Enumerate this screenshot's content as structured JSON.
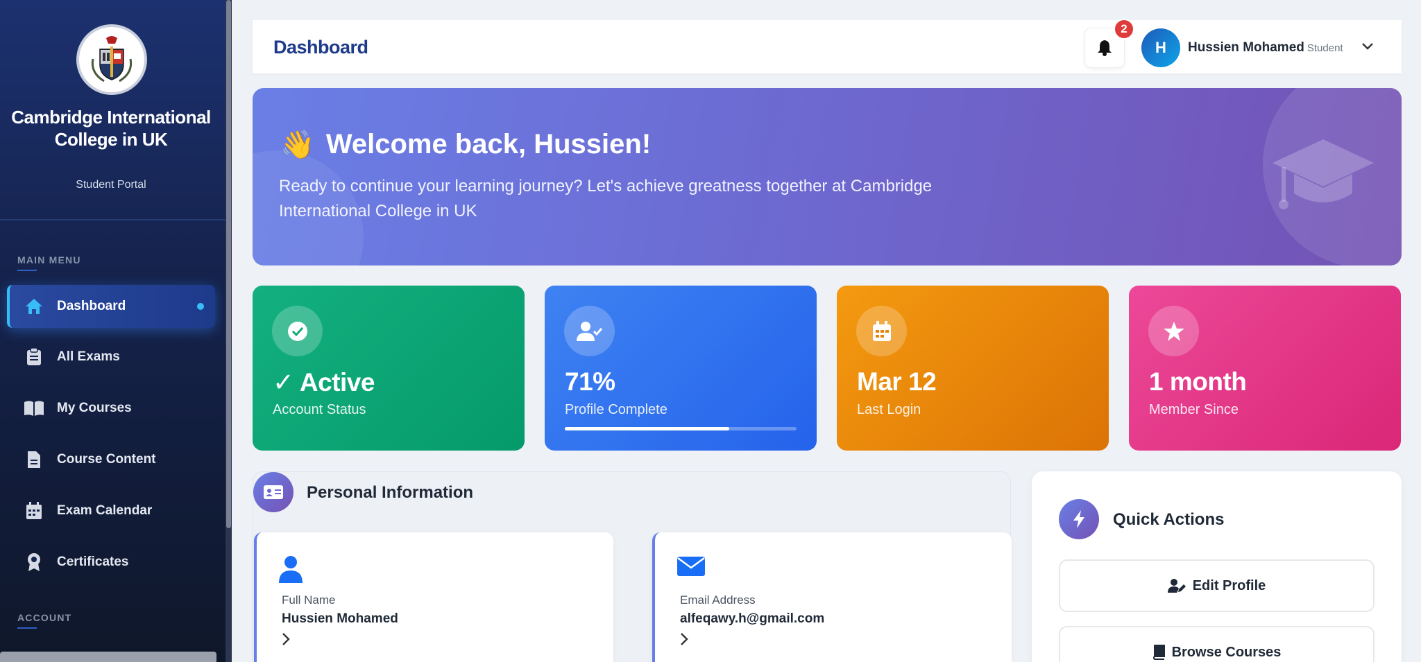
{
  "sidebar": {
    "college_name": "Cambridge International College in UK",
    "portal_label": "Student Portal",
    "sections": {
      "main": "MAIN MENU",
      "account": "ACCOUNT"
    },
    "items": [
      {
        "label": "Dashboard",
        "icon": "home-icon",
        "active": true
      },
      {
        "label": "All Exams",
        "icon": "clipboard-icon"
      },
      {
        "label": "My Courses",
        "icon": "book-open-icon"
      },
      {
        "label": "Course Content",
        "icon": "file-icon"
      },
      {
        "label": "Exam Calendar",
        "icon": "calendar-icon"
      },
      {
        "label": "Certificates",
        "icon": "award-icon"
      }
    ]
  },
  "header": {
    "title": "Dashboard",
    "notification_count": "2",
    "user": {
      "initial": "H",
      "name": "Hussien Mohamed",
      "role": "Student"
    }
  },
  "banner": {
    "emoji": "👋",
    "title": "Welcome back, Hussien!",
    "subtitle": "Ready to continue your learning journey? Let's achieve greatness together at Cambridge International College in UK"
  },
  "stats": [
    {
      "value": "✓ Active",
      "label": "Account Status",
      "icon": "check-circle-icon",
      "color": "#10b981"
    },
    {
      "value": "71%",
      "label": "Profile Complete",
      "icon": "user-check-icon",
      "color": "#3b82f6",
      "progress": 71
    },
    {
      "value": "Mar 12",
      "label": "Last Login",
      "icon": "calendar-icon",
      "color": "#f59e0b"
    },
    {
      "value": "1 month",
      "label": "Member Since",
      "icon": "star-icon",
      "color": "#ec4899"
    }
  ],
  "personal_info": {
    "title": "Personal Information",
    "fields": [
      {
        "key": "Full Name",
        "value": "Hussien Mohamed",
        "icon": "user-icon"
      },
      {
        "key": "Email Address",
        "value": "alfeqawy.h@gmail.com",
        "icon": "envelope-icon"
      }
    ]
  },
  "quick_actions": {
    "title": "Quick Actions",
    "buttons": [
      {
        "label": "Edit Profile",
        "icon": "user-edit-icon"
      },
      {
        "label": "Browse Courses",
        "icon": "book-icon"
      }
    ]
  },
  "colors": {
    "primary": "#1e3a8a",
    "accent": "#667eea",
    "badge": "#e03b3b"
  }
}
